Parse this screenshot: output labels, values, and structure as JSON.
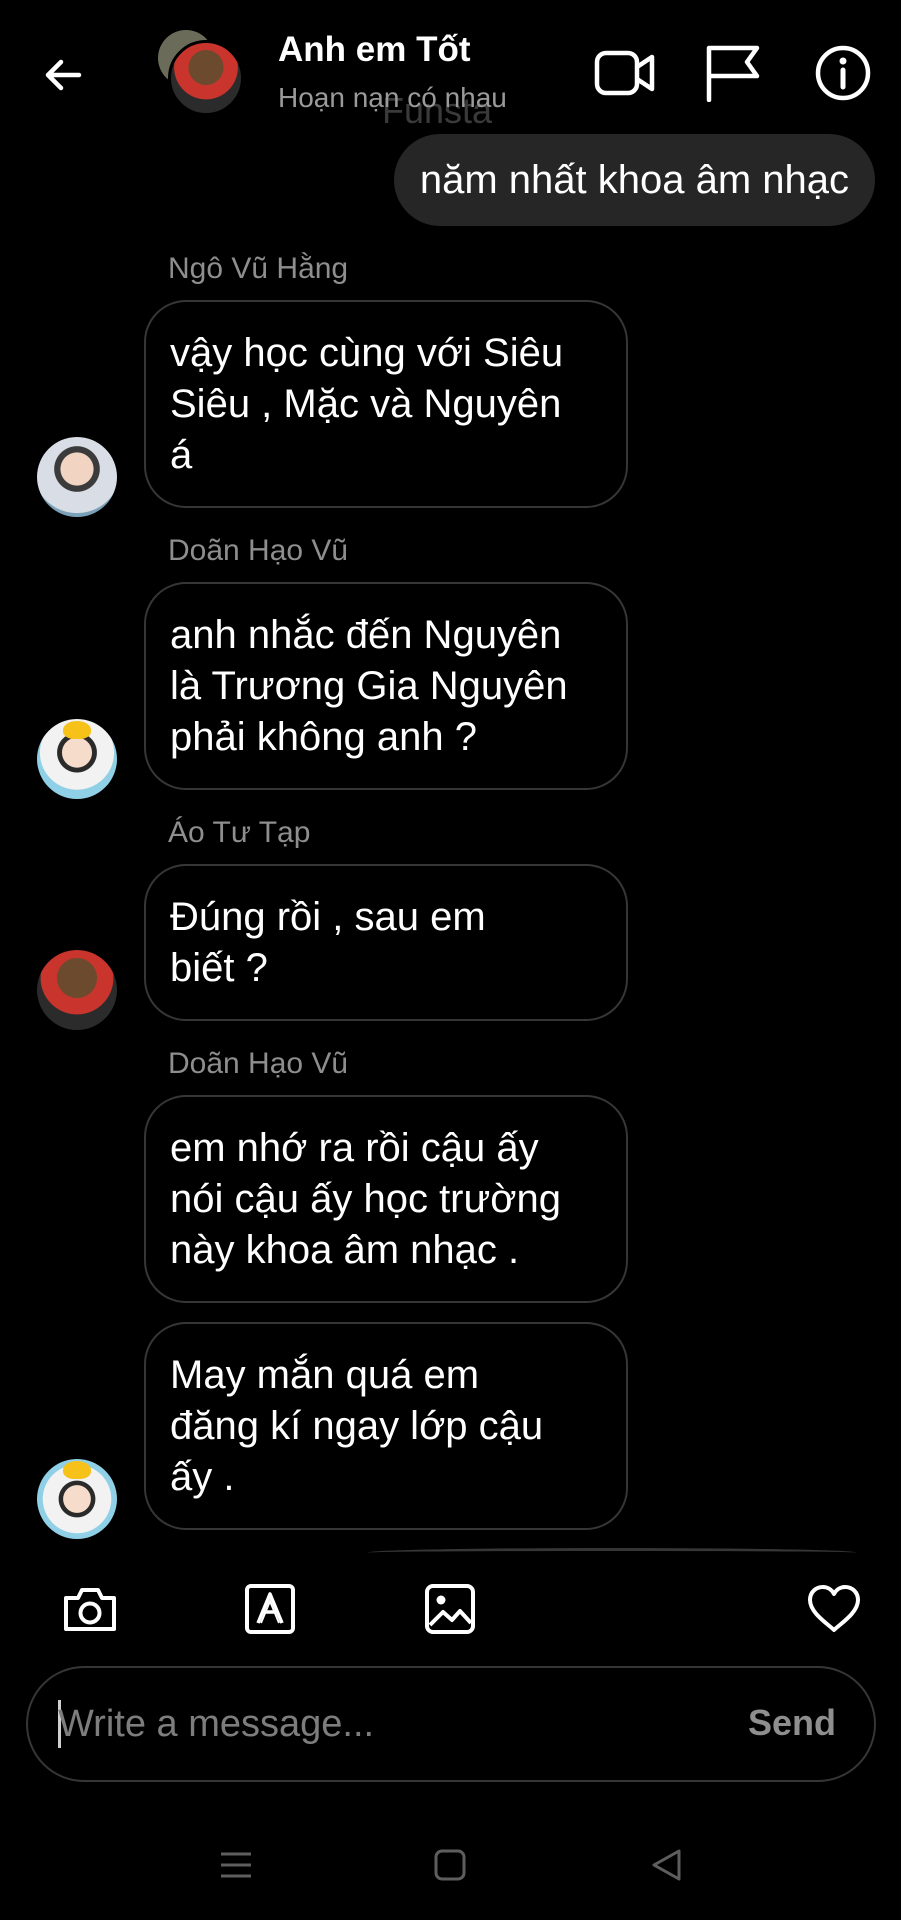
{
  "header": {
    "title": "Anh em Tốt",
    "subtitle": "Hoạn nạn có nhau",
    "ghost_text": "Funsta",
    "icons": [
      "back-arrow-icon",
      "video-call-icon",
      "flag-icon",
      "info-icon"
    ]
  },
  "messages": {
    "sent": {
      "text": "năm nhất khoa âm nhạc"
    },
    "received": [
      {
        "sender": "Ngô Vũ Hằng",
        "lines": [
          "vậy học cùng với Siêu",
          "Siêu , Mặc và Nguyên",
          "á"
        ]
      },
      {
        "sender": "Doãn Hạo Vũ",
        "lines": [
          "anh nhắc đến Nguyên",
          "là Trương Gia Nguyên",
          "phải không anh ?"
        ]
      },
      {
        "sender": "Áo Tư Tạp",
        "lines": [
          "Đúng rồi , sau em",
          "biết ?"
        ]
      },
      {
        "sender": "Doãn Hạo Vũ",
        "lines": [
          "em nhớ ra rồi cậu ấy",
          "nói cậu ấy học trường",
          "này khoa âm nhạc ."
        ]
      },
      {
        "sender": "",
        "lines": [
          "May mắn quá em",
          "đăng kí ngay lớp cậu",
          "ấy ."
        ]
      }
    ]
  },
  "toolbar": {
    "icons": [
      "camera-icon",
      "text-style-icon",
      "gallery-icon",
      "heart-icon"
    ]
  },
  "composer": {
    "placeholder": "Write a message...",
    "send_label": "Send"
  },
  "navbar": {
    "icons": [
      "menu-icon",
      "home-icon",
      "back-icon"
    ]
  }
}
